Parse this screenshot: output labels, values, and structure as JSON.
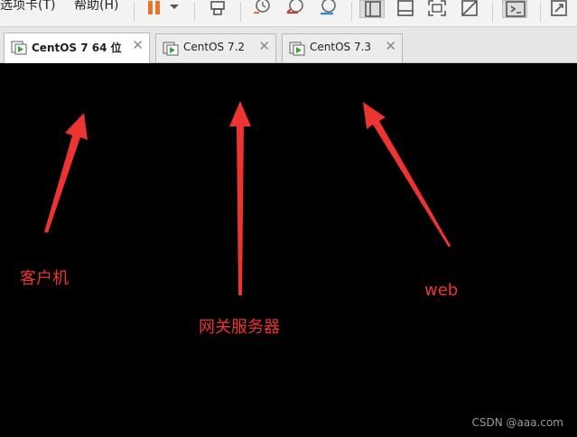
{
  "menu": {
    "items": [
      "选项卡(T)",
      "帮助(H)"
    ]
  },
  "toolbar": {
    "buttons": [
      "pause-icon",
      "dropdown-arrow-icon",
      "send-keys-icon",
      "snapshot-icon",
      "revert-snapshot-icon",
      "snapshot-manager-icon",
      "library-view-icon",
      "thumbnail-view-icon",
      "fullscreen-icon",
      "unity-icon",
      "console-view-icon",
      "stretch-icon"
    ],
    "accent": "#e8742a"
  },
  "tabs": [
    {
      "label": "CentOS 7 64 位",
      "active": true
    },
    {
      "label": "CentOS 7.2",
      "active": false
    },
    {
      "label": "CentOS 7.3",
      "active": false
    }
  ],
  "annotations": {
    "client": "客户机",
    "gateway": "网关服务器",
    "web": "web",
    "color": "#ee3333"
  },
  "watermark": "CSDN @aaa.com"
}
